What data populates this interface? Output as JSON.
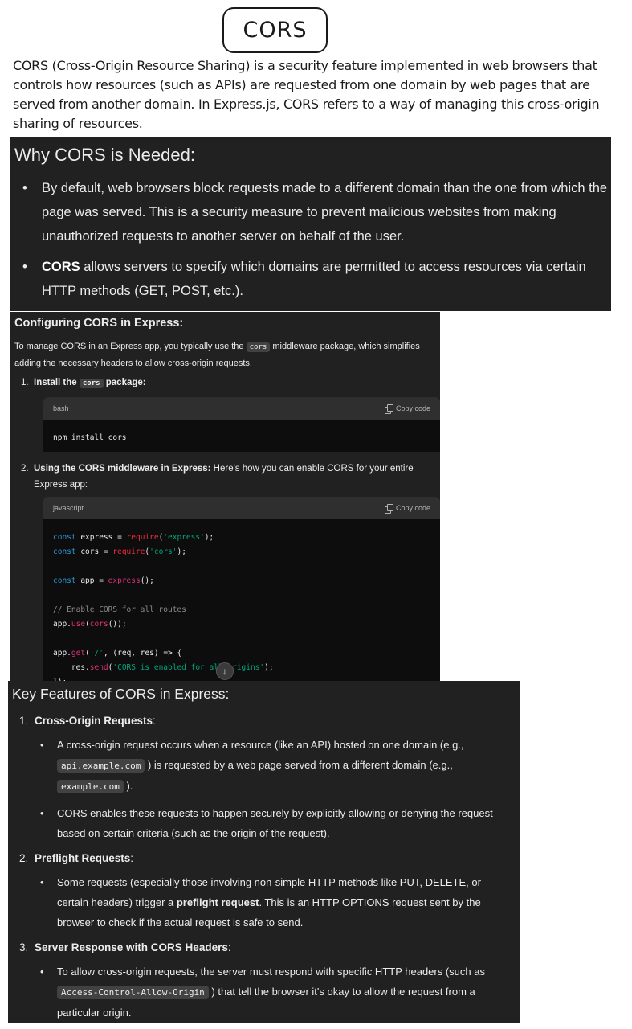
{
  "title": "CORS",
  "intro": "CORS (Cross-Origin Resource Sharing) is a security feature implemented in web browsers that controls how resources (such as APIs) are requested from one domain by web pages that are served from another domain. In Express.js, CORS refers to a way of managing this cross-origin sharing of resources.",
  "why": {
    "heading": "Why CORS is Needed:",
    "bullet1": "By default, web browsers block requests made to a different domain than the one from which the page was served. This is a security measure to prevent malicious websites from making unauthorized requests to another server on behalf of the user.",
    "bullet2_bold": "CORS",
    "bullet2_rest": " allows servers to specify which domains are permitted to access resources via certain HTTP methods (GET, POST, etc.)."
  },
  "config": {
    "heading": "Configuring CORS in Express:",
    "para_a": "To manage CORS in an Express app, you typically use the ",
    "para_code": "cors",
    "para_b": " middleware package, which simplifies adding the necessary headers to allow cross-origin requests.",
    "step1_num": "1.",
    "step1_a": "Install the ",
    "step1_code": "cors",
    "step1_b": " package:",
    "code1_lang": "bash",
    "copy_label": "Copy code",
    "code1": "npm install cors",
    "step2_num": "2.",
    "step2_bold": "Using the CORS middleware in Express:",
    "step2_rest": " Here's how you can enable CORS for your entire",
    "step2_cont": "Express app:",
    "code2_lang": "javascript",
    "code2": {
      "l1_kw": "const",
      "l1_mid": " express = ",
      "l1_req": "require",
      "l1_open": "(",
      "l1_str": "'express'",
      "l1_end": ");",
      "l2_kw": "const",
      "l2_mid": " cors = ",
      "l2_req": "require",
      "l2_open": "(",
      "l2_str": "'cors'",
      "l2_end": ");",
      "l3_kw": "const",
      "l3_mid": " app = ",
      "l3_fn": "express",
      "l3_end": "();",
      "l4_cm": "// Enable CORS for all routes",
      "l5_a": "app.",
      "l5_fn": "use",
      "l5_b": "(",
      "l5_fn2": "cors",
      "l5_end": "());",
      "l6_a": "app.",
      "l6_fn": "get",
      "l6_b": "(",
      "l6_str": "'/'",
      "l6_end": ", (req, res) => {",
      "l7_a": "    res.",
      "l7_fn": "send",
      "l7_b": "(",
      "l7_str": "'CORS is enabled for all origins'",
      "l7_end": ");",
      "l8": "});"
    }
  },
  "features": {
    "heading": "Key Features of CORS in Express:",
    "f1_num": "1.",
    "f1_title": "Cross-Origin Requests",
    "f1_colon": ":",
    "f1_b1_a": "A cross-origin request occurs when a resource (like an API) hosted on one domain (e.g.,",
    "f1_b1_code1": "api.example.com",
    "f1_b1_b": " ) is requested by a web page served from a different domain (e.g.,",
    "f1_b1_code2": "example.com",
    "f1_b1_c": " ).",
    "f1_b2": "CORS enables these requests to happen securely by explicitly allowing or denying the request based on certain criteria (such as the origin of the request).",
    "f2_num": "2.",
    "f2_title": "Preflight Requests",
    "f2_colon": ":",
    "f2_b1_a": "Some requests (especially those involving non-simple HTTP methods like PUT, DELETE, or certain headers) trigger a ",
    "f2_b1_bold": "preflight request",
    "f2_b1_b": ". This is an HTTP OPTIONS request sent by the browser to check if the actual request is safe to send.",
    "f3_num": "3.",
    "f3_title": "Server Response with CORS Headers",
    "f3_colon": ":",
    "f3_b1_a": "To allow cross-origin requests, the server must respond with specific HTTP headers (such as",
    "f3_b1_code": "Access-Control-Allow-Origin",
    "f3_b1_b": " ) that tell the browser it's okay to allow the request from a particular origin."
  },
  "colors": {
    "panel_bg": "#212121",
    "code_bg": "#0d0d0d",
    "keyword": "#2e95d3",
    "string": "#00a67d",
    "function": "#df3079"
  },
  "icons": {
    "copy": "copy-icon",
    "scroll": "arrow-down-icon"
  }
}
